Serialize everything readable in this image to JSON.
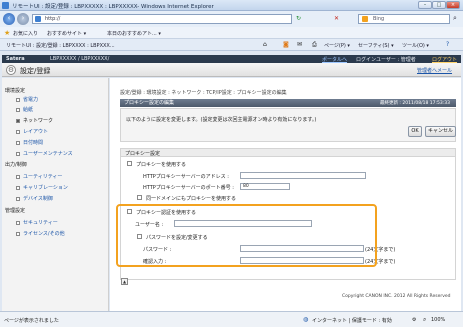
{
  "window": {
    "title": "リモートUI : 設定/登録 : LBPXXXXX : LBPXXXXX- Windows Internet Explorer",
    "url": "http://",
    "search_placeholder": "Bing"
  },
  "favbar": {
    "favorites": "お気に入り",
    "suggested": "おすすめサイト ▾",
    "webslice": "本日のおすすめアト... ▾"
  },
  "tabbar": {
    "tab": "リモートUI : 設定/登録 : LBPXXXX : LBPXXX...",
    "page_menu": "ページ(P) ▾",
    "safety_menu": "セーフティ(S) ▾",
    "tools_menu": "ツール(O) ▾"
  },
  "apphead": {
    "brand": "Satera",
    "device": "LBPXXXXX / LBPXXXXX/",
    "portal": "ポータルへ",
    "login_user": "ログインユーザー : 管理者",
    "logout": "ログアウト",
    "page_title": "設定/登録",
    "mail_admin": "管理者へメール"
  },
  "sidebar": {
    "categories": [
      {
        "label": "環境設定",
        "items": [
          {
            "label": "省電力",
            "selected": false
          },
          {
            "label": "給紙",
            "selected": false
          },
          {
            "label": "ネットワーク",
            "selected": true
          },
          {
            "label": "レイアウト",
            "selected": false
          },
          {
            "label": "日付時間",
            "selected": false
          },
          {
            "label": "ユーザーメンテナンス",
            "selected": false
          }
        ]
      },
      {
        "label": "出力/制御",
        "items": [
          {
            "label": "ユーティリティー",
            "selected": false
          },
          {
            "label": "キャリブレーション",
            "selected": false
          },
          {
            "label": "デバイス制御",
            "selected": false
          }
        ]
      },
      {
        "label": "管理設定",
        "items": [
          {
            "label": "セキュリティー",
            "selected": false
          },
          {
            "label": "ライセンス/その他",
            "selected": false
          }
        ]
      }
    ]
  },
  "main": {
    "breadcrumb": "設定/登録 : 環境設定 : ネットワーク : TCP/IP設定 : プロキシー設定の編集",
    "edit_header": "プロキシー設定の編集",
    "last_updated": "最終更新 : 2011/08/18 17:53:33",
    "instruction": "以下のように設定を変更します。(設定変更は次回主電源オン時より有効になります。)",
    "ok_button": "OK",
    "cancel_button": "キャンセル",
    "proxy_section": "プロキシー設定",
    "use_proxy": "プロキシーを使用する",
    "http_address_label": "HTTPプロキシーサーバーのアドレス :",
    "http_address_value": "",
    "http_port_label": "HTTPプロキシーサーバーのポート番号 :",
    "http_port_value": "80",
    "same_domain": "同一ドメインにもプロキシーを使用する",
    "use_auth": "プロキシー認証を使用する",
    "username_label": "ユーザー名 :",
    "username_value": "",
    "set_password": "パスワードを設定/変更する",
    "password_label": "パスワード :",
    "password_value": "",
    "password_hint": "(24文字まで)",
    "confirm_label": "確認入力 :",
    "confirm_value": "",
    "confirm_hint": "(24文字まで)",
    "top_link": "▲",
    "copyright": "Copyright CANON INC. 2012 All Rights Reserved"
  },
  "statusbar": {
    "left": "ページが表示されました",
    "zone": "インターネット | 保護モード : 有効",
    "zoom": "100%"
  }
}
